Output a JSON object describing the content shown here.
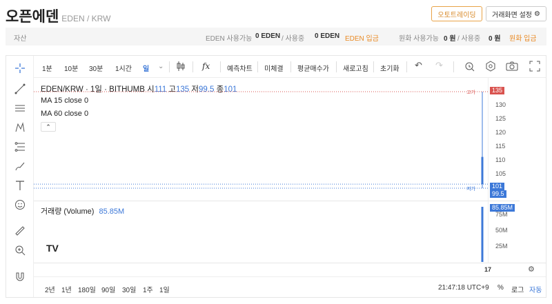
{
  "header": {
    "title": "오픈에덴",
    "pair": "EDEN / KRW",
    "auto_trade": "오토트레이딩",
    "settings": "거래화면 설정"
  },
  "assets": {
    "label": "자산",
    "eden_avail_label": "EDEN 사용가능",
    "eden_avail_value": "0 EDEN",
    "eden_using_label": "/ 사용중",
    "eden_using_value": "0 EDEN",
    "eden_deposit": "EDEN 입금",
    "krw_avail_label": "원화 사용가능",
    "krw_avail_value": "0 원",
    "krw_using_label": "/ 사용중",
    "krw_using_value": "0 원",
    "krw_deposit": "원화 입금"
  },
  "toolbar": {
    "intervals": [
      "1분",
      "10분",
      "30분",
      "1시간",
      "일"
    ],
    "fx": "fx",
    "items": [
      "예측차트",
      "미체결",
      "평균매수가",
      "새로고침",
      "초기화"
    ]
  },
  "legend": {
    "symbol": "EDEN/KRW · 1일 · BITHUMB",
    "o_label": "시",
    "o": "111",
    "h_label": "고",
    "h": "135",
    "l_label": "저",
    "l": "99.5",
    "c_label": "종",
    "c": "101",
    "ma15": "MA 15 close 0",
    "ma60": "MA 60 close 0"
  },
  "price_axis": {
    "ticks": [
      "130",
      "125",
      "120",
      "115",
      "110",
      "105"
    ],
    "high_tag": "135",
    "high_label": "고가",
    "low_label": "저가",
    "last_tag": "101",
    "low_tag": "99.5"
  },
  "volume": {
    "label": "거래량 (Volume)",
    "value": "85.85M",
    "ticks": [
      "75M",
      "50M",
      "25M"
    ],
    "tag": "85.85M"
  },
  "x_axis": {
    "label": "17"
  },
  "bottom": {
    "ranges": [
      "2년",
      "1년",
      "180일",
      "90일",
      "30일",
      "1주",
      "1일"
    ],
    "time": "21:47:18 UTC+9",
    "pct": "%",
    "log": "로그",
    "auto": "자동"
  },
  "chart_data": {
    "type": "candlestick",
    "candles": [
      {
        "x": "17",
        "open": 111,
        "high": 135,
        "low": 99.5,
        "close": 101
      }
    ],
    "volume": [
      {
        "x": "17",
        "value": 85.85
      }
    ],
    "volume_unit": "M",
    "ylim": [
      99.5,
      135
    ]
  },
  "colors": {
    "accent": "#e98a24",
    "down": "#3c78d8",
    "high": "#d9534f"
  }
}
